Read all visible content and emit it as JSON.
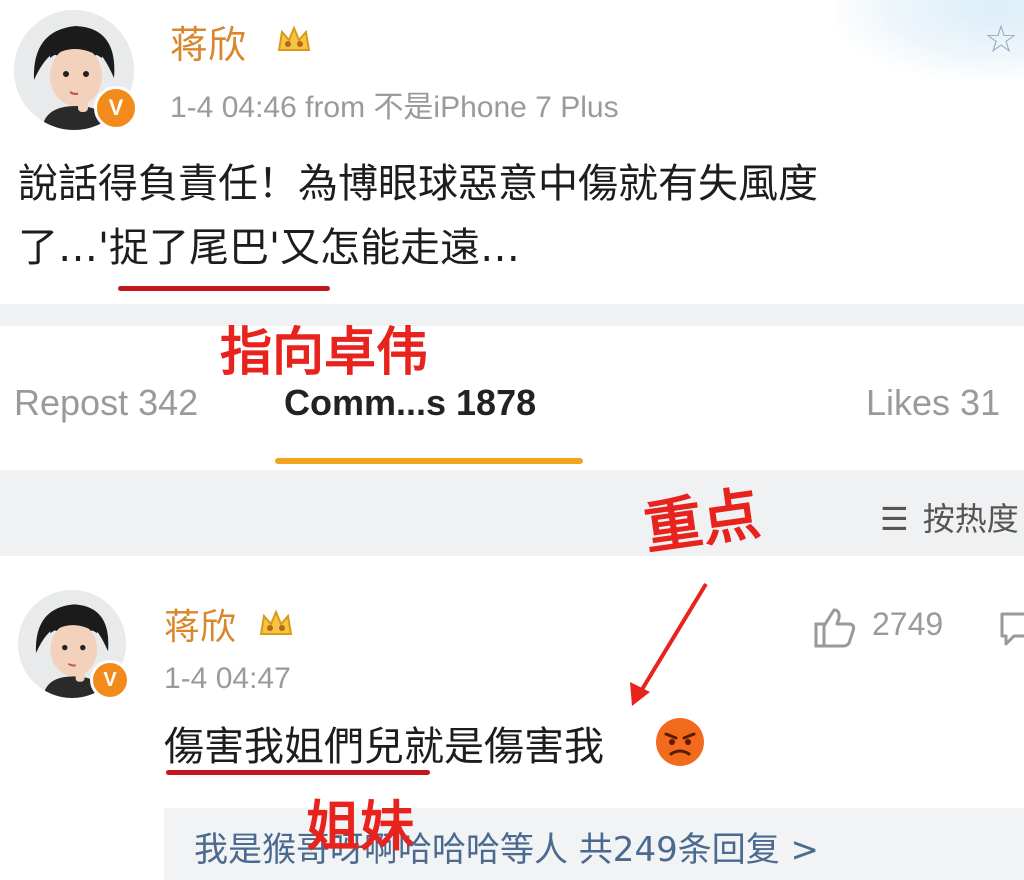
{
  "post": {
    "username": "蒋欣",
    "meta": "1-4 04:46  from 不是iPhone 7 Plus",
    "text_line1": "說話得負責任！為博眼球惡意中傷就有失風度",
    "text_line2": "了…'捉了尾巴'又怎能走遠…"
  },
  "annotations": {
    "point_to": "指向卓伟",
    "key_point": "重点",
    "sisters": "姐妹"
  },
  "tabs": {
    "repost": "Repost 342",
    "comments": "Comm...s 1878",
    "likes": "Likes 31"
  },
  "sort": {
    "label": "按热度"
  },
  "comment": {
    "username": "蒋欣",
    "time": "1-4 04:47",
    "text": "傷害我姐們兒就是傷害我",
    "like_count": "2749",
    "replies_summary": "我是猴哥呀啊哈哈哈等人 共249条回复 >"
  },
  "icons": {
    "star": "star-icon",
    "crown": "crown-icon",
    "verified": "verified-badge-icon",
    "like": "thumbs-up-icon",
    "reply": "comment-icon",
    "sort": "sort-icon",
    "emoji": "angry-face-emoji-icon"
  },
  "colors": {
    "username": "#d9862c",
    "accent_underline": "#f0a51c",
    "annotation_red": "#e8221d",
    "badge_orange": "#f28a1c",
    "link_blue": "#4a6a8f"
  }
}
